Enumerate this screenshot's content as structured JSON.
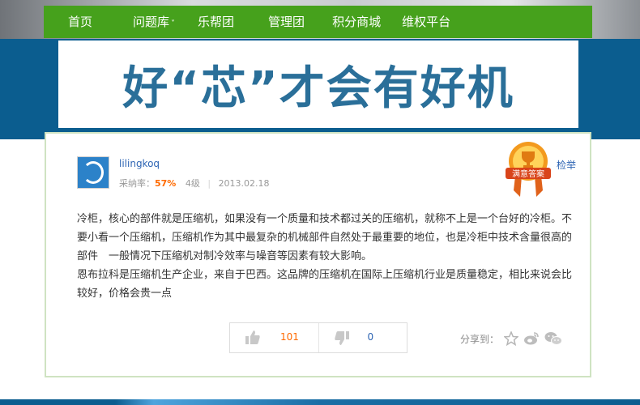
{
  "nav": {
    "items": [
      {
        "label": "首页"
      },
      {
        "label": "问题库"
      },
      {
        "label": "乐帮团"
      },
      {
        "label": "管理团"
      },
      {
        "label": "积分商城"
      },
      {
        "label": "维权平台"
      }
    ],
    "dropdown_caret": "˅"
  },
  "banner": {
    "title": "好“芯”才会有好机"
  },
  "answer": {
    "username": "lilingkoq",
    "rate_label": "采纳率：",
    "rate_value": "57%",
    "level": "4级",
    "date": "2013.02.18",
    "badge_text": "满意答案",
    "report_label": "检举",
    "paragraphs": [
      "冷柜，核心的部件就是压缩机，如果没有一个质量和技术都过关的压缩机，就称不上是一个台好的冷柜。不要小看一个压缩机，压缩机作为其中最复杂的机械部件自然处于最重要的地位，也是冷柜中技术含量很高的部件　一般情况下压缩机对制冷效率与噪音等因素有较大影响。",
      "恩布拉科是压缩机生产企业，来自于巴西。这品牌的压缩机在国际上压缩机行业是质量稳定，相比来说会比较好，价格会贵一点"
    ]
  },
  "votes": {
    "up_count": "101",
    "down_count": "0"
  },
  "share": {
    "label": "分享到：",
    "icons": [
      "star-icon",
      "weibo-icon",
      "wechat-icon"
    ]
  },
  "colors": {
    "nav_green": "#46a11c",
    "band_blue": "#0b5d8f",
    "title_blue": "#2a6f99",
    "link_blue": "#2d64b3",
    "accent_orange": "#ff6a00"
  }
}
